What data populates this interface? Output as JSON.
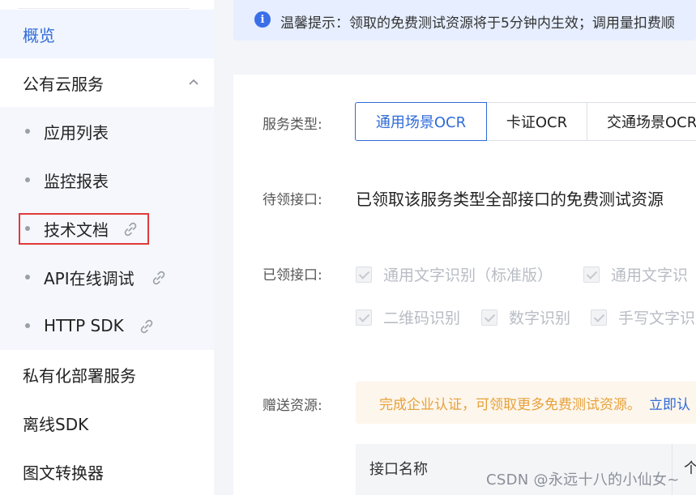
{
  "sidebar": {
    "overview": "概览",
    "public_cloud": "公有云服务",
    "sub_items": {
      "app_list": "应用列表",
      "monitor": "监控报表",
      "tech_docs": "技术文档",
      "api_debug": "API在线调试",
      "http_sdk": "HTTP SDK"
    },
    "private_deploy": "私有化部署服务",
    "offline_sdk": "离线SDK",
    "converter": "图文转换器"
  },
  "notice": {
    "text": "温馨提示：领取的免费测试资源将于5分钟内生效；调用量扣费顺"
  },
  "form": {
    "service_type_label": "服务类型:",
    "tabs": [
      "通用场景OCR",
      "卡证OCR",
      "交通场景OCR"
    ],
    "pending_label": "待领接口:",
    "pending_value": "已领取该服务类型全部接口的免费测试资源",
    "claimed_label": "已领接口:",
    "claimed": [
      "通用文字识别（标准版）",
      "通用文字识",
      "二维码识别",
      "数字识别",
      "手写文字识"
    ],
    "gift_label": "赠送资源:",
    "gift_text": "完成企业认证，可领取更多免费测试资源。",
    "gift_link": "立即认"
  },
  "table": {
    "col_name": "接口名称",
    "col_more": "个"
  },
  "watermark": "CSDN @永远十八的小仙女~",
  "colors": {
    "accent": "#2f6bd8",
    "highlight_box": "#e03a3a",
    "warning_text": "#e6a23c"
  }
}
